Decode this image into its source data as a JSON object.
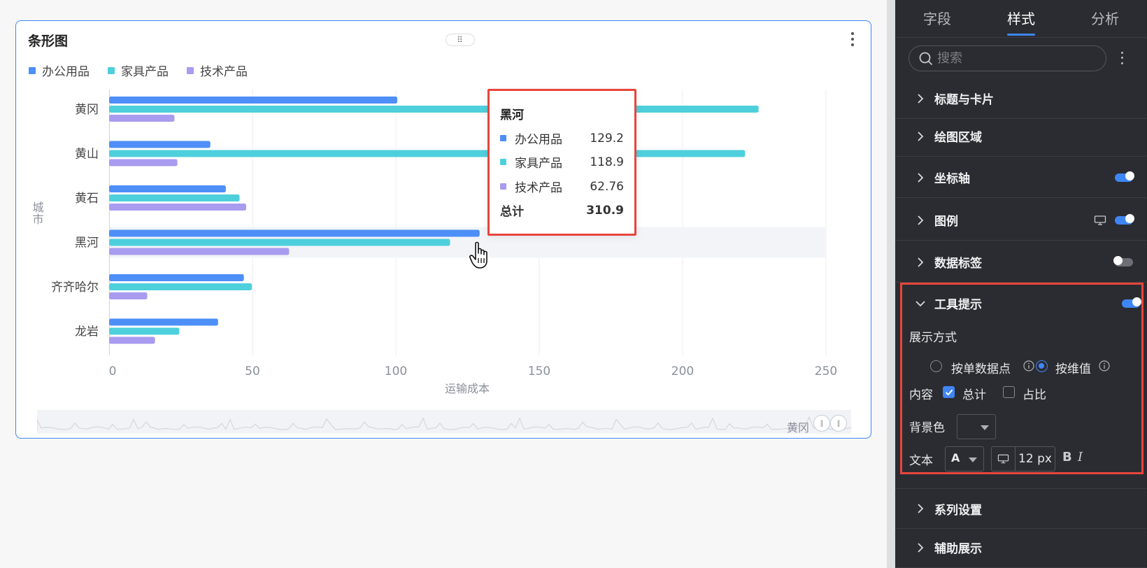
{
  "card": {
    "title": "条形图",
    "legend": [
      {
        "label": "办公用品",
        "color": "#4e8ef7"
      },
      {
        "label": "家具产品",
        "color": "#4ecfdc"
      },
      {
        "label": "技术产品",
        "color": "#a89bf0"
      }
    ],
    "minimap_label": "黄冈"
  },
  "chart_data": {
    "type": "bar",
    "orientation": "horizontal",
    "categories": [
      "黄冈",
      "黄山",
      "黄石",
      "黑河",
      "齐齐哈尔",
      "龙岩"
    ],
    "series": [
      {
        "name": "办公用品",
        "color": "#4e8ef7",
        "values": [
          100.5,
          35.3,
          40.7,
          129.2,
          47.0,
          38.0
        ]
      },
      {
        "name": "家具产品",
        "color": "#4ecfdc",
        "values": [
          226.5,
          221.8,
          45.5,
          118.9,
          49.8,
          24.5
        ]
      },
      {
        "name": "技术产品",
        "color": "#a89bf0",
        "values": [
          22.8,
          23.8,
          47.8,
          62.76,
          13.3,
          16.0
        ]
      }
    ],
    "xlabel": "运输成本",
    "ylabel": "城市",
    "xlim": [
      0,
      250
    ],
    "xticks": [
      "0",
      "50",
      "100",
      "150",
      "200",
      "250"
    ],
    "grid": true,
    "highlighted_category": "黑河",
    "legend_position": "top-left"
  },
  "tooltip": {
    "title": "黑河",
    "rows": [
      {
        "label": "办公用品",
        "value": "129.2",
        "color": "#4e8ef7"
      },
      {
        "label": "家具产品",
        "value": "118.9",
        "color": "#4ecfdc"
      },
      {
        "label": "技术产品",
        "value": "62.76",
        "color": "#a89bf0"
      }
    ],
    "total_label": "总计",
    "total_value": "310.9"
  },
  "panel": {
    "tabs": [
      "字段",
      "样式",
      "分析"
    ],
    "active_tab": "样式",
    "search_placeholder": "搜索",
    "sections": {
      "title_card": "标题与卡片",
      "plot_area": "绘图区域",
      "axis": "坐标轴",
      "legend": "图例",
      "data_label": "数据标签",
      "tooltip": "工具提示",
      "series": "系列设置",
      "aux": "辅助展示"
    },
    "tooltip_settings": {
      "display_mode_label": "展示方式",
      "option_single": "按单数据点",
      "option_dimension": "按维值",
      "content_label": "内容",
      "total_option": "总计",
      "percent_option": "占比",
      "bg_color_label": "背景色",
      "text_label": "文本",
      "font_color_glyph": "A",
      "font_size": "12 px",
      "bold": "B",
      "italic": "I"
    }
  }
}
